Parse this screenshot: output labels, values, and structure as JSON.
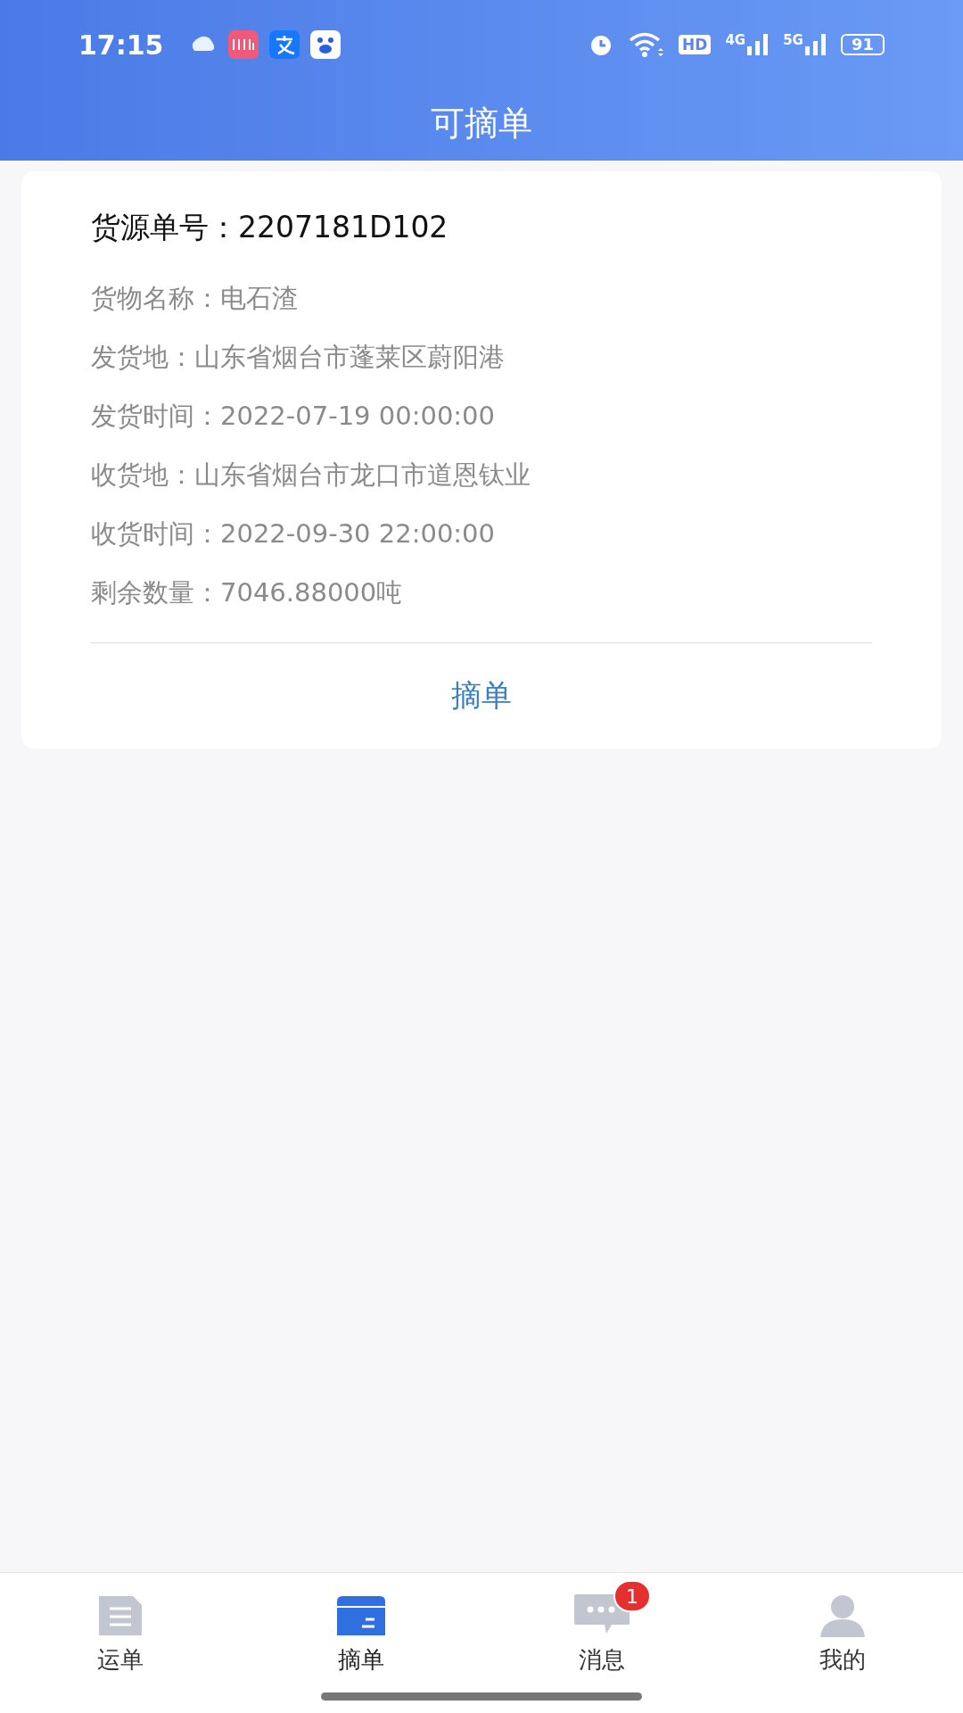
{
  "status_bar": {
    "time": "17:15",
    "hd": "HD",
    "net_1": "4G",
    "net_2": "5G",
    "battery": "91"
  },
  "header": {
    "title": "可摘单"
  },
  "card": {
    "title": "货源单号：2207181D102",
    "fields": [
      {
        "label": "货物名称：",
        "value": "电石渣"
      },
      {
        "label": "发货地：",
        "value": "山东省烟台市蓬莱区蔚阳港"
      },
      {
        "label": "发货时间：",
        "value": "2022-07-19 00:00:00"
      },
      {
        "label": "收货地：",
        "value": "山东省烟台市龙口市道恩钛业"
      },
      {
        "label": "收货时间：",
        "value": "2022-09-30 22:00:00"
      },
      {
        "label": "剩余数量：",
        "value": "7046.88000吨"
      }
    ],
    "action": "摘单"
  },
  "tabs": [
    {
      "kind": "document",
      "label": "运单",
      "selected": false
    },
    {
      "kind": "box",
      "label": "摘单",
      "selected": true
    },
    {
      "kind": "chat",
      "label": "消息",
      "selected": false,
      "badge": "1"
    },
    {
      "kind": "person",
      "label": "我的",
      "selected": false
    }
  ]
}
